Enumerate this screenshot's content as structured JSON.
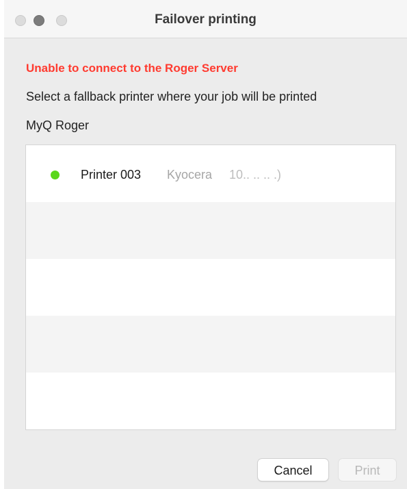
{
  "window": {
    "title": "Failover printing"
  },
  "dialog": {
    "error_message": "Unable to connect to the Roger Server",
    "instruction": "Select a fallback printer where your job will be printed",
    "server_name": "MyQ Roger"
  },
  "printers": [
    {
      "name": "Printer 003",
      "model": "Kyocera",
      "address": "10.. .. .. .)",
      "status_color": "#5bd71c"
    }
  ],
  "buttons": {
    "cancel_label": "Cancel",
    "print_label": "Print",
    "print_enabled": false
  },
  "colors": {
    "error": "#ff3b30",
    "status_online": "#5bd71c"
  }
}
